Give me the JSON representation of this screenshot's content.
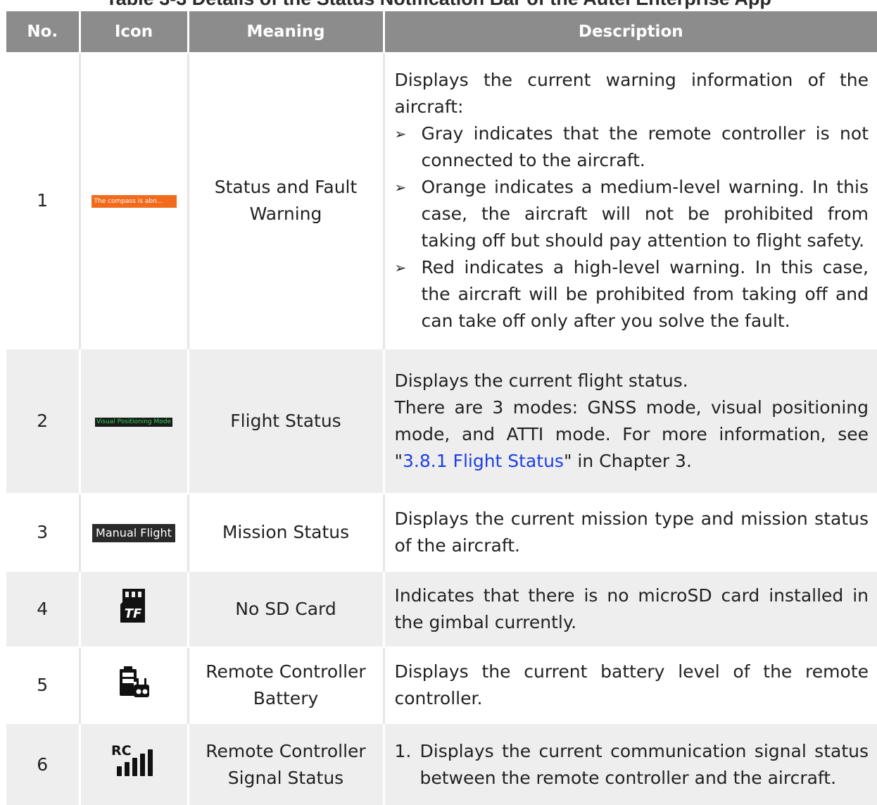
{
  "caption": "Table 3-3   Details of the Status Notification Bar of the Autel Enterprise App",
  "headers": {
    "no": "No.",
    "icon": "Icon",
    "meaning": "Meaning",
    "description": "Description"
  },
  "rows": [
    {
      "no": "1",
      "icon_text": "The compass is abn...",
      "icon_color": "#f26a1b",
      "meaning": "Status and Fault Warning",
      "desc_intro": "Displays the current warning information of the aircraft:",
      "bullets": [
        "Gray indicates that the remote controller is not connected to the aircraft.",
        "Orange indicates a medium-level warning. In this case, the aircraft will not be prohibited from taking off but should pay attention to flight safety.",
        "Red indicates a high-level warning. In this case, the aircraft will be prohibited from taking off and can take off only after you solve the fault."
      ]
    },
    {
      "no": "2",
      "icon_text": "Visual Positioning Mode",
      "icon_color": "#2fd35a",
      "meaning": "Flight Status",
      "desc_line1": "Displays the current flight status.",
      "desc_line2_before": "There are 3 modes: GNSS mode, visual positioning mode, and ATTI mode. For more information, see \"",
      "desc_link": "3.8.1 Flight Status",
      "desc_line2_after": "\" in Chapter 3."
    },
    {
      "no": "3",
      "icon_text": "Manual Flight",
      "meaning": "Mission Status",
      "desc": "Displays the current mission type and mission status of the aircraft."
    },
    {
      "no": "4",
      "icon": "microsd-tf-card-icon",
      "icon_label": "TF",
      "meaning": "No SD Card",
      "desc": "Indicates that there is no microSD card installed in the gimbal currently."
    },
    {
      "no": "5",
      "icon": "remote-controller-battery-icon",
      "meaning": "Remote Controller Battery",
      "desc": "Displays the current battery level of the remote controller."
    },
    {
      "no": "6",
      "icon": "rc-signal-icon",
      "icon_label": "RC",
      "meaning": "Remote Controller Signal Status",
      "numbered": [
        {
          "num": "1.",
          "text": "Displays the current communication signal status between the remote controller and the aircraft."
        }
      ]
    }
  ]
}
